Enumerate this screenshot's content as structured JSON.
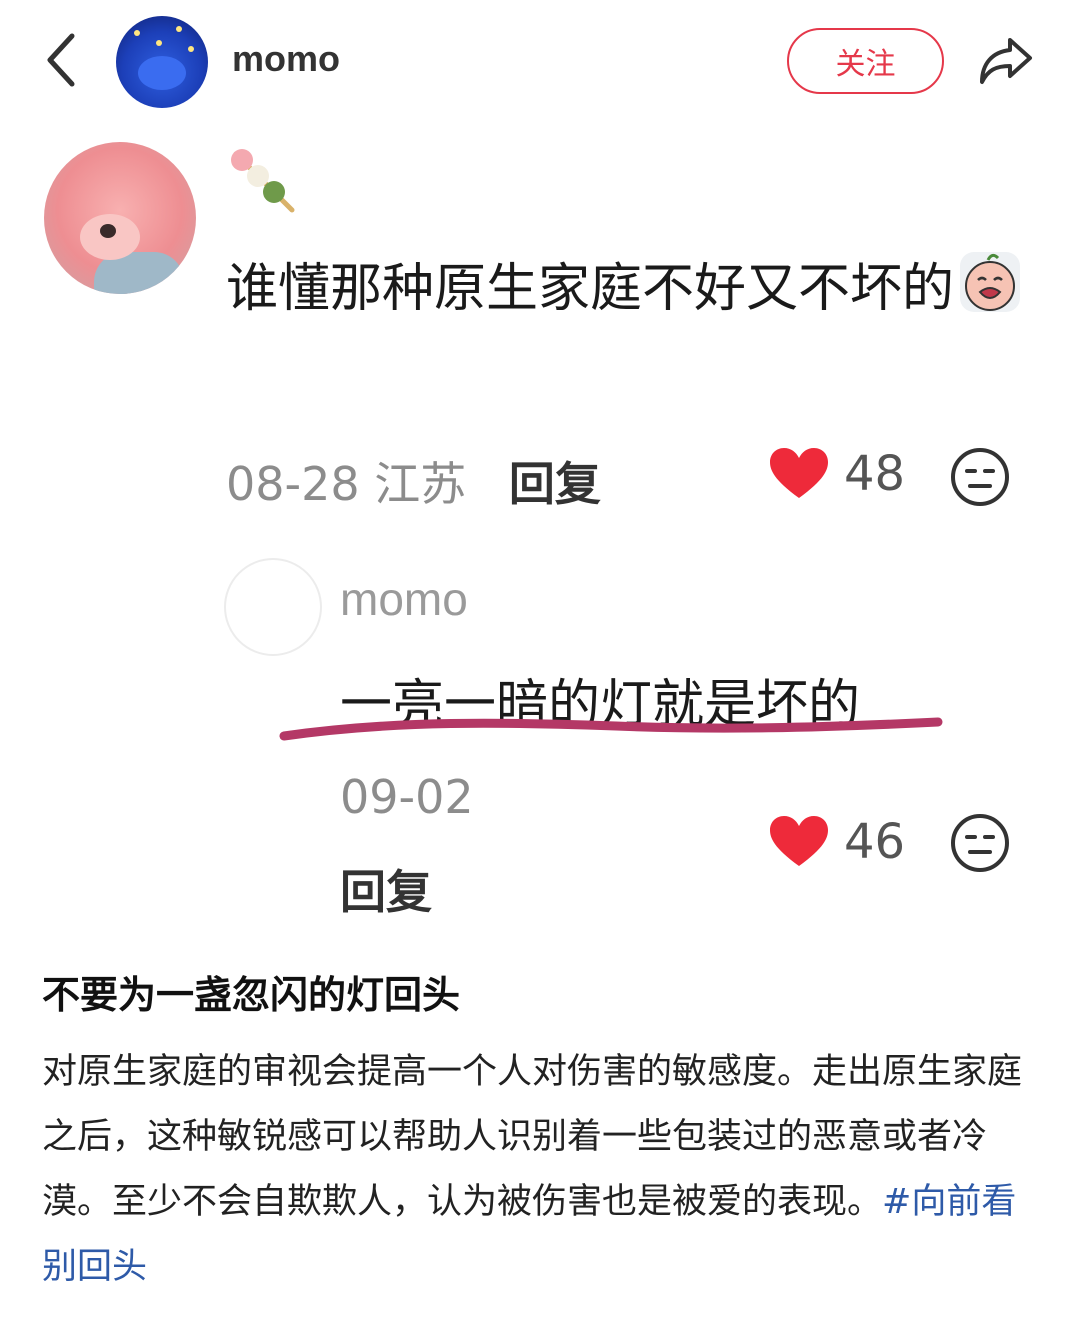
{
  "header": {
    "username": "momo",
    "follow_label": "关注"
  },
  "comment": {
    "text": "谁懂那种原生家庭不好又不坏的",
    "date": "08-28",
    "location": "江苏",
    "reply_label": "回复",
    "likes": "48"
  },
  "reply": {
    "username": "momo",
    "text": "一亮一暗的灯就是坏的",
    "date": "09-02",
    "reply_label": "回复",
    "likes": "46"
  },
  "article": {
    "title": "不要为一盏忽闪的灯回头",
    "body": "对原生家庭的审视会提高一个人对伤害的敏感度。走出原生家庭之后，这种敏锐感可以帮助人识别着一些包装过的恶意或者冷漠。至少不会自欺欺人，认为被伤害也是被爱的表现。",
    "hashtag": "#向前看别回头"
  },
  "colors": {
    "accent_red": "#e5384a",
    "heart": "#ee2a3a",
    "underline": "#b43866",
    "hashtag": "#2e5aa8"
  },
  "icons": [
    "back-icon",
    "share-icon",
    "heart-icon",
    "dislike-icon",
    "dango-emoji",
    "crying-emoji"
  ]
}
